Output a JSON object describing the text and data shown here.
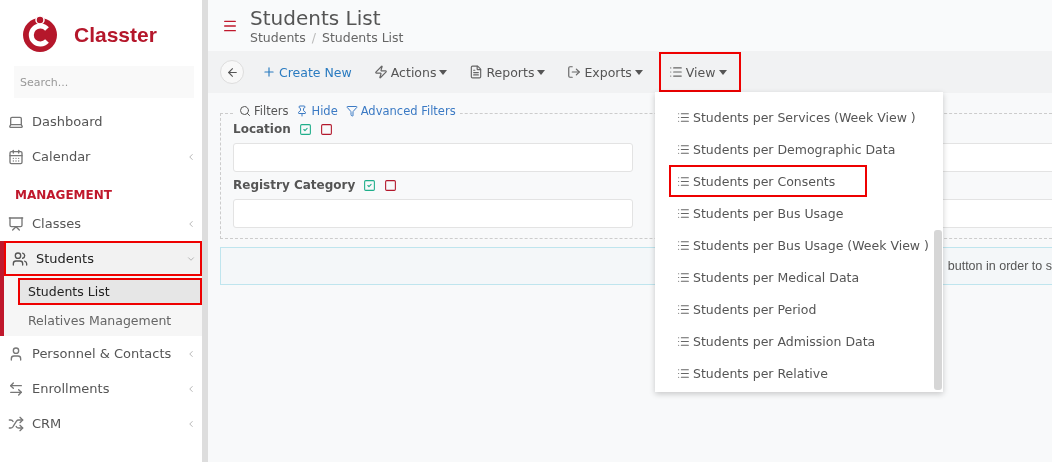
{
  "brand": {
    "name": "Classter"
  },
  "sidebar": {
    "search": {
      "placeholder": "Search..."
    },
    "items": [
      {
        "kind": "item",
        "label": "Dashboard",
        "has_arrow": false,
        "highlighted": false
      },
      {
        "kind": "item",
        "label": "Calendar",
        "has_arrow": true,
        "highlighted": false
      },
      {
        "kind": "section",
        "label": "MANAGEMENT"
      },
      {
        "kind": "item",
        "label": "Classes",
        "has_arrow": true,
        "highlighted": false
      },
      {
        "kind": "item",
        "label": "Students",
        "has_arrow": true,
        "expanded": true,
        "highlighted": true,
        "children": [
          {
            "label": "Students List",
            "selected": true,
            "highlighted": true
          },
          {
            "label": "Relatives Management",
            "selected": false,
            "highlighted": false
          }
        ]
      },
      {
        "kind": "item",
        "label": "Personnel & Contacts",
        "has_arrow": true,
        "highlighted": false
      },
      {
        "kind": "item",
        "label": "Enrollments",
        "has_arrow": true,
        "highlighted": false
      },
      {
        "kind": "item",
        "label": "CRM",
        "has_arrow": true,
        "highlighted": false
      }
    ]
  },
  "header": {
    "title": "Students List",
    "breadcrumb": [
      "Students",
      "Students List"
    ],
    "separator": "/"
  },
  "toolbar": {
    "buttons": [
      {
        "kind": "primary",
        "label": "Create New",
        "dropdown": false,
        "highlighted": false
      },
      {
        "kind": "plain",
        "label": "Actions",
        "dropdown": true,
        "highlighted": false
      },
      {
        "kind": "plain",
        "label": "Reports",
        "dropdown": true,
        "highlighted": false
      },
      {
        "kind": "plain",
        "label": "Exports",
        "dropdown": true,
        "highlighted": false
      },
      {
        "kind": "plain",
        "label": "View",
        "dropdown": true,
        "highlighted": true
      }
    ]
  },
  "filters": {
    "links": [
      {
        "label": "Filters",
        "kind": "plain"
      },
      {
        "label": "Hide",
        "kind": "link"
      },
      {
        "label": "Advanced Filters",
        "kind": "link"
      }
    ],
    "fields": [
      {
        "label": "Location"
      },
      {
        "label": "Registry Category"
      }
    ]
  },
  "alert": {
    "text": "button in order to s"
  },
  "view_menu": {
    "items": [
      {
        "label": "Students per Services (Week View )",
        "highlighted": false
      },
      {
        "label": "Students per Demographic Data",
        "highlighted": false
      },
      {
        "label": "Students per Consents",
        "highlighted": true
      },
      {
        "label": "Students per Bus Usage",
        "highlighted": false
      },
      {
        "label": "Students per Bus Usage (Week View )",
        "highlighted": false
      },
      {
        "label": "Students per Medical Data",
        "highlighted": false
      },
      {
        "label": "Students per Period",
        "highlighted": false
      },
      {
        "label": "Students per Admission Data",
        "highlighted": false
      },
      {
        "label": "Students per Relative",
        "highlighted": false
      }
    ]
  }
}
